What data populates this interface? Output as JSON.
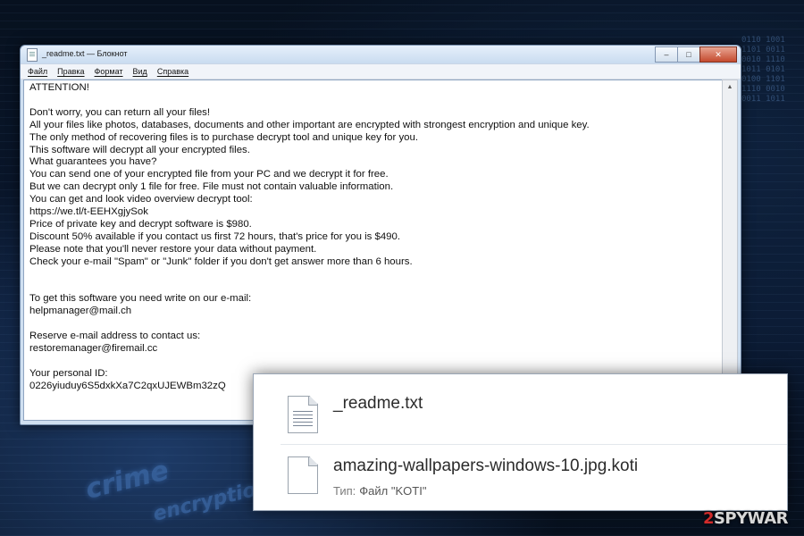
{
  "window": {
    "title": "_readme.txt — Блокнот",
    "buttons": {
      "minimize": "–",
      "maximize": "□",
      "close": "✕"
    }
  },
  "menu": [
    {
      "label": "Файл"
    },
    {
      "label": "Правка"
    },
    {
      "label": "Формат"
    },
    {
      "label": "Вид"
    },
    {
      "label": "Справка"
    }
  ],
  "note_text": "ATTENTION!\n\nDon't worry, you can return all your files!\nAll your files like photos, databases, documents and other important are encrypted with strongest encryption and unique key.\nThe only method of recovering files is to purchase decrypt tool and unique key for you.\nThis software will decrypt all your encrypted files.\nWhat guarantees you have?\nYou can send one of your encrypted file from your PC and we decrypt it for free.\nBut we can decrypt only 1 file for free. File must not contain valuable information.\nYou can get and look video overview decrypt tool:\nhttps://we.tl/t-EEHXgjySok\nPrice of private key and decrypt software is $980.\nDiscount 50% available if you contact us first 72 hours, that's price for you is $490.\nPlease note that you'll never restore your data without payment.\nCheck your e-mail \"Spam\" or \"Junk\" folder if you don't get answer more than 6 hours.\n\n\nTo get this software you need write on our e-mail:\nhelpmanager@mail.ch\n\nReserve e-mail address to contact us:\nrestoremanager@firemail.cc\n\nYour personal ID:\n0226yiuduy6S5dxkXa7C2qxUJEWBm32zQ",
  "files": [
    {
      "name": "_readme.txt",
      "type_label": "",
      "type_value": ""
    },
    {
      "name": "amazing-wallpapers-windows-10.jpg.koti",
      "type_label": "Тип:",
      "type_value": "Файл \"KOTI\""
    }
  ],
  "watermark": {
    "prefix": "2",
    "suffix": "SPYWAR"
  },
  "colors": {
    "background": "#06101f",
    "window_frame": "#cfdff0",
    "close_button": "#c44a2e",
    "watermark_accent": "#d12b2b"
  }
}
